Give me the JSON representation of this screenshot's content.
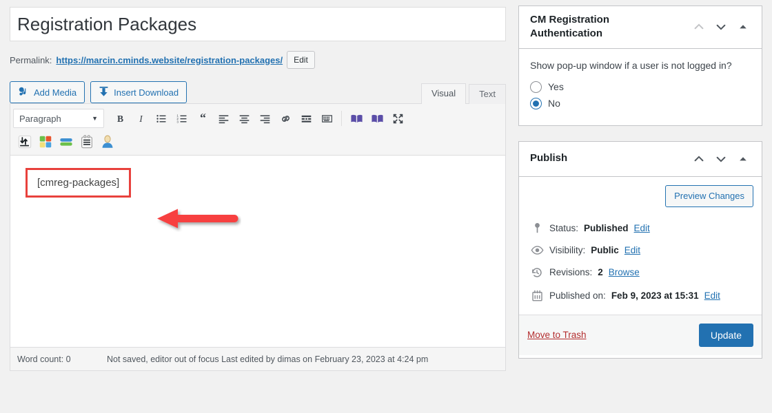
{
  "editor": {
    "title_value": "Registration Packages",
    "title_placeholder": "Add title",
    "permalink_label": "Permalink:",
    "permalink_url": "https://marcin.cminds.website/registration-packages/",
    "edit_slug_label": "Edit",
    "add_media_label": "Add Media",
    "insert_download_label": "Insert Download",
    "tabs": [
      {
        "label": "Visual",
        "active": true
      },
      {
        "label": "Text",
        "active": false
      }
    ],
    "format_select_value": "Paragraph",
    "content_shortcode": "[cmreg-packages]",
    "toolbar_row1": [
      "bold-icon",
      "italic-icon",
      "bulleted-list-icon",
      "numbered-list-icon",
      "blockquote-icon",
      "align-left-icon",
      "align-center-icon",
      "align-right-icon",
      "insert-link-icon",
      "read-more-icon",
      "toolbar-toggle-icon",
      "book-icon",
      "book-alt-icon",
      "fullscreen-icon"
    ],
    "toolbar_row2": [
      "sort-arrows-icon",
      "color-squares-icon",
      "stacked-bars-icon",
      "form-list-icon",
      "user-avatar-icon"
    ],
    "status_wordcount": "Word count: 0",
    "status_autosave": "Not saved, editor out of focus Last edited by dimas on February 23, 2023 at 4:24 pm"
  },
  "annotation": {
    "highlight_color": "#e8413c",
    "arrow_color": "#f73f3f",
    "arrow_direction": "left"
  },
  "sidebar": {
    "auth_panel": {
      "title": "CM Registration Authentication",
      "question": "Show pop-up window if a user is not logged in?",
      "options": [
        {
          "label": "Yes",
          "selected": false
        },
        {
          "label": "No",
          "selected": true
        }
      ]
    },
    "publish_panel": {
      "title": "Publish",
      "preview_label": "Preview Changes",
      "rows": [
        {
          "icon": "pin-icon",
          "label": "Status:",
          "value": "Published",
          "link": "Edit"
        },
        {
          "icon": "eye-icon",
          "label": "Visibility:",
          "value": "Public",
          "link": "Edit"
        },
        {
          "icon": "revisions-icon",
          "label": "Revisions:",
          "value": "2",
          "link": "Browse"
        },
        {
          "icon": "calendar-icon",
          "label": "Published on:",
          "value": "Feb 9, 2023 at 15:31",
          "link": "Edit"
        }
      ],
      "trash_label": "Move to Trash",
      "update_label": "Update"
    },
    "header_icons": [
      "chevron-up-icon",
      "chevron-down-icon",
      "toggle-triangle-icon"
    ]
  },
  "theme": {
    "accent": "#2271b1",
    "danger": "#b32d2e",
    "page_bg": "#f1f1f1"
  }
}
